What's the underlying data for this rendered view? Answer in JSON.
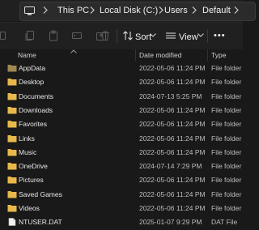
{
  "address": {
    "crumbs": [
      "This PC",
      "Local Disk (C:)",
      "Users",
      "Default"
    ]
  },
  "toolbar": {
    "sort_label": "Sort",
    "view_label": "View",
    "more_label": "•••"
  },
  "columns": {
    "name": "Name",
    "date": "Date modified",
    "type": "Type"
  },
  "files": [
    {
      "name": "AppData",
      "date": "2022-05-06 11:24 PM",
      "type": "File folder",
      "icon": "hidden-folder-icon"
    },
    {
      "name": "Desktop",
      "date": "2022-05-06 11:24 PM",
      "type": "File folder",
      "icon": "folder-icon"
    },
    {
      "name": "Documents",
      "date": "2024-07-13 5:25 PM",
      "type": "File folder",
      "icon": "folder-icon"
    },
    {
      "name": "Downloads",
      "date": "2022-05-06 11:24 PM",
      "type": "File folder",
      "icon": "folder-icon"
    },
    {
      "name": "Favorites",
      "date": "2022-05-06 11:24 PM",
      "type": "File folder",
      "icon": "folder-icon"
    },
    {
      "name": "Links",
      "date": "2022-05-06 11:24 PM",
      "type": "File folder",
      "icon": "folder-icon"
    },
    {
      "name": "Music",
      "date": "2022-05-06 11:24 PM",
      "type": "File folder",
      "icon": "folder-icon"
    },
    {
      "name": "OneDrive",
      "date": "2024-07-14 7:29 PM",
      "type": "File folder",
      "icon": "folder-icon"
    },
    {
      "name": "Pictures",
      "date": "2022-05-06 11:24 PM",
      "type": "File folder",
      "icon": "folder-icon"
    },
    {
      "name": "Saved Games",
      "date": "2022-05-06 11:24 PM",
      "type": "File folder",
      "icon": "folder-icon"
    },
    {
      "name": "Videos",
      "date": "2022-05-06 11:24 PM",
      "type": "File folder",
      "icon": "folder-icon"
    },
    {
      "name": "NTUSER.DAT",
      "date": "2025-01-07 9:29 PM",
      "type": "DAT File",
      "icon": "file-icon"
    }
  ],
  "colors": {
    "folder": "#e8b84a",
    "hidden_folder": "#a08850",
    "background": "#191919"
  }
}
